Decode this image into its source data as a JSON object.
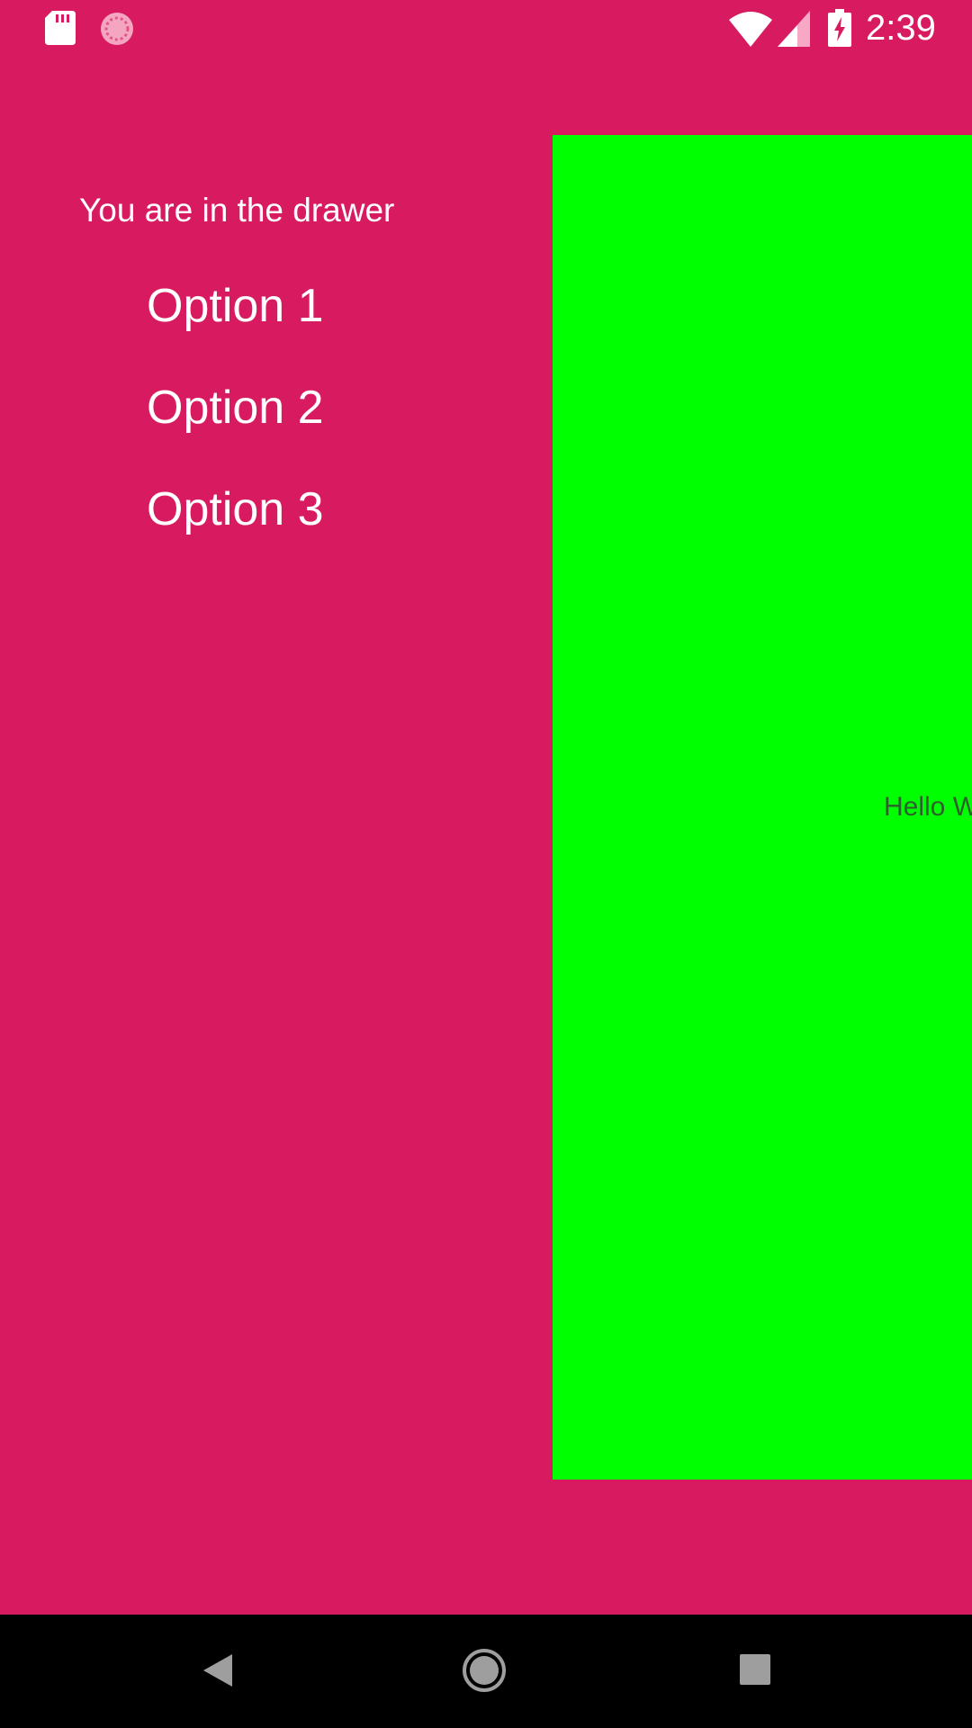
{
  "status_bar": {
    "time": "2:39",
    "icons": [
      "sd-card-icon",
      "sync-icon",
      "wifi-icon",
      "signal-icon",
      "battery-charging-icon"
    ]
  },
  "drawer": {
    "header": "You are in the drawer",
    "options": [
      {
        "label": "Option 1"
      },
      {
        "label": "Option 2"
      },
      {
        "label": "Option 3"
      }
    ]
  },
  "content": {
    "text": "Hello World!"
  },
  "nav_bar": {
    "buttons": [
      "back-icon",
      "home-icon",
      "recents-icon"
    ]
  },
  "colors": {
    "drawer_background": "#D81B60",
    "content_background": "#00FF00",
    "nav_background": "#000000",
    "text_primary": "#FFFFFF"
  }
}
